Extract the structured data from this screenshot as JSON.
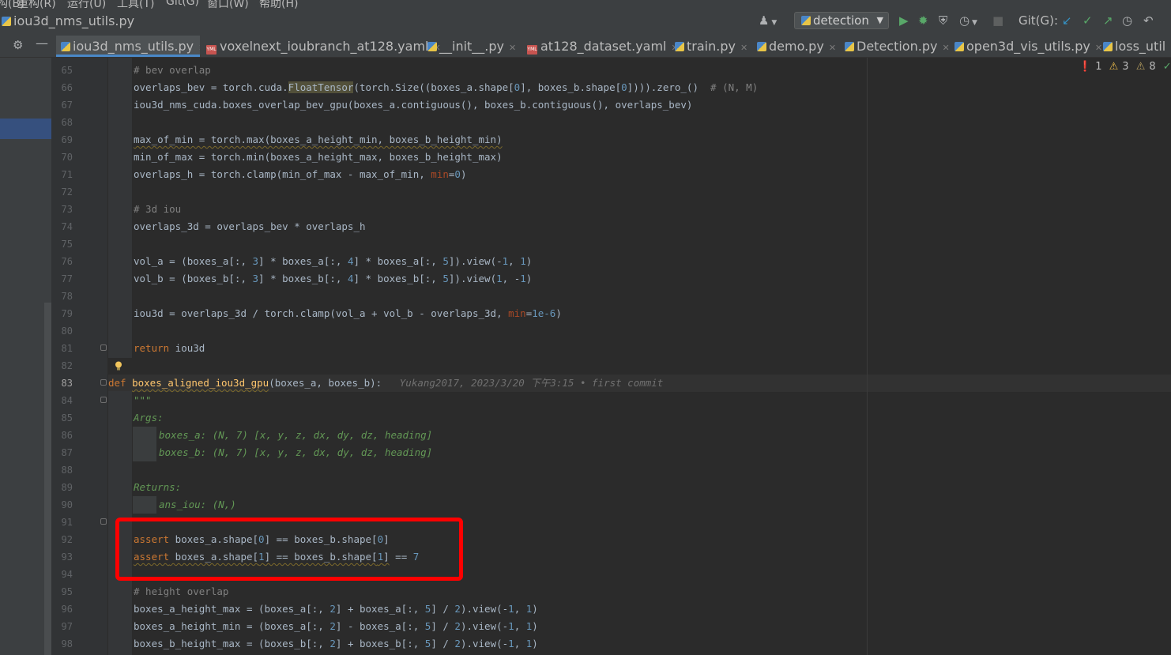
{
  "menu": [
    "构(B)",
    "重构(R)",
    "运行(U)",
    "工具(T)",
    "Git(G)",
    "窗口(W)",
    "帮助(H)"
  ],
  "breadcrumb": "iou3d_nms_utils.py",
  "toolbar": {
    "run_config": "detection",
    "git_label": "Git(G):"
  },
  "tabs": [
    {
      "label": "iou3d_nms_utils.py",
      "icon": "python-icon"
    },
    {
      "label": "voxelnext_ioubranch_at128.yaml",
      "icon": "yaml-icon"
    },
    {
      "label": "__init__.py",
      "icon": "python-icon"
    },
    {
      "label": "at128_dataset.yaml",
      "icon": "yaml-icon"
    },
    {
      "label": "train.py",
      "icon": "python-icon"
    },
    {
      "label": "demo.py",
      "icon": "python-icon"
    },
    {
      "label": "Detection.py",
      "icon": "python-icon"
    },
    {
      "label": "open3d_vis_utils.py",
      "icon": "python-icon"
    },
    {
      "label": "loss_util",
      "icon": "python-icon"
    }
  ],
  "inspections": {
    "errors": "1",
    "warnings": "3",
    "weak_warnings": "8",
    "ok": "1"
  },
  "editor": {
    "line_numbers": [
      "65",
      "66",
      "67",
      "68",
      "69",
      "70",
      "71",
      "72",
      "73",
      "74",
      "75",
      "76",
      "77",
      "78",
      "79",
      "80",
      "81",
      "82",
      "83",
      "84",
      "85",
      "86",
      "87",
      "88",
      "89",
      "90",
      "91",
      "92",
      "93",
      "94",
      "95",
      "96",
      "97",
      "98"
    ],
    "current_line": "83",
    "blame": "Yukang2017, 2023/3/20 下午3:15 • first commit",
    "code": {
      "l65": "# bev overlap",
      "l85": "Args:",
      "l86": "boxes_a: (N, 7) [x, y, z, dx, dy, dz, heading]",
      "l87": "boxes_b: (N, 7) [x, y, z, dx, dy, dz, heading]",
      "l89": "Returns:",
      "l90": "ans_iou: (N,)",
      "l95": "# height overlap"
    }
  },
  "highlight_box": {
    "color": "#ff0000"
  }
}
